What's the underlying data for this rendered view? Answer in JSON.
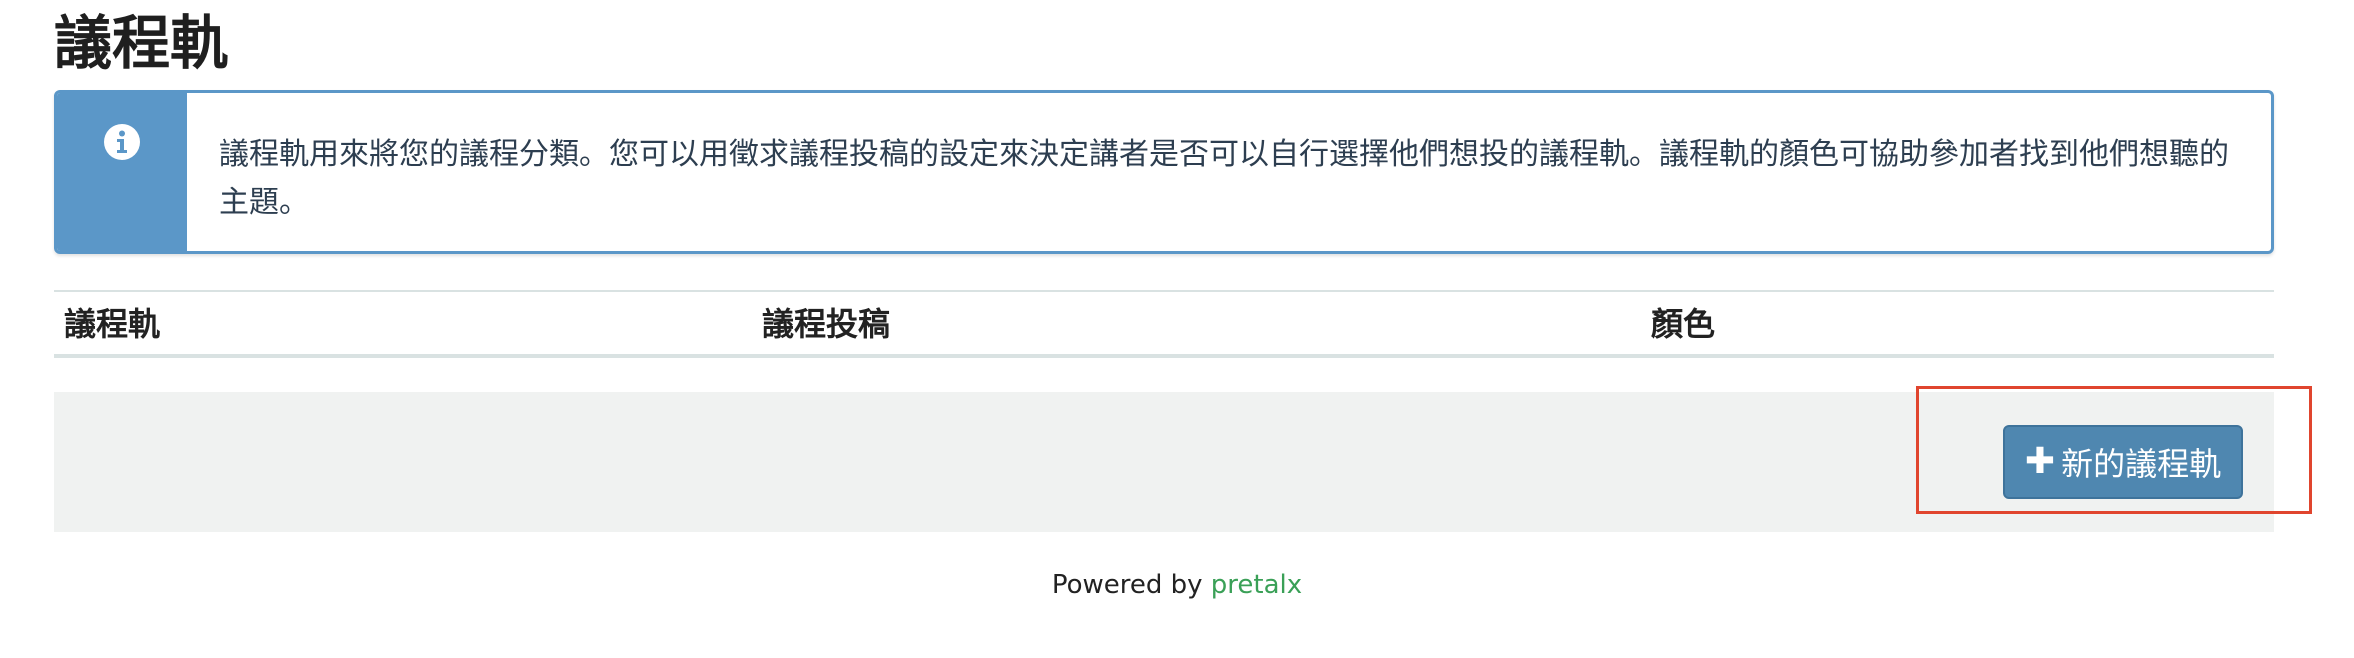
{
  "page": {
    "title": "議程軌"
  },
  "info": {
    "icon": "info-icon",
    "text": "議程軌用來將您的議程分類。您可以用徵求議程投稿的設定來決定講者是否可以自行選擇他們想投的議程軌。議程軌的顏色可協助參加者找到他們想聽的主題。"
  },
  "table": {
    "headers": [
      "議程軌",
      "議程投稿",
      "顏色"
    ]
  },
  "actions": {
    "add_track_label": "新的議程軌",
    "add_icon": "plus-icon"
  },
  "footer": {
    "powered_by": "Powered by",
    "brand": "pretalx"
  },
  "colors": {
    "info_accent": "#5b97c8",
    "button": "#4f87b0",
    "highlight": "#e0452e",
    "brand_link": "#3aa057"
  }
}
